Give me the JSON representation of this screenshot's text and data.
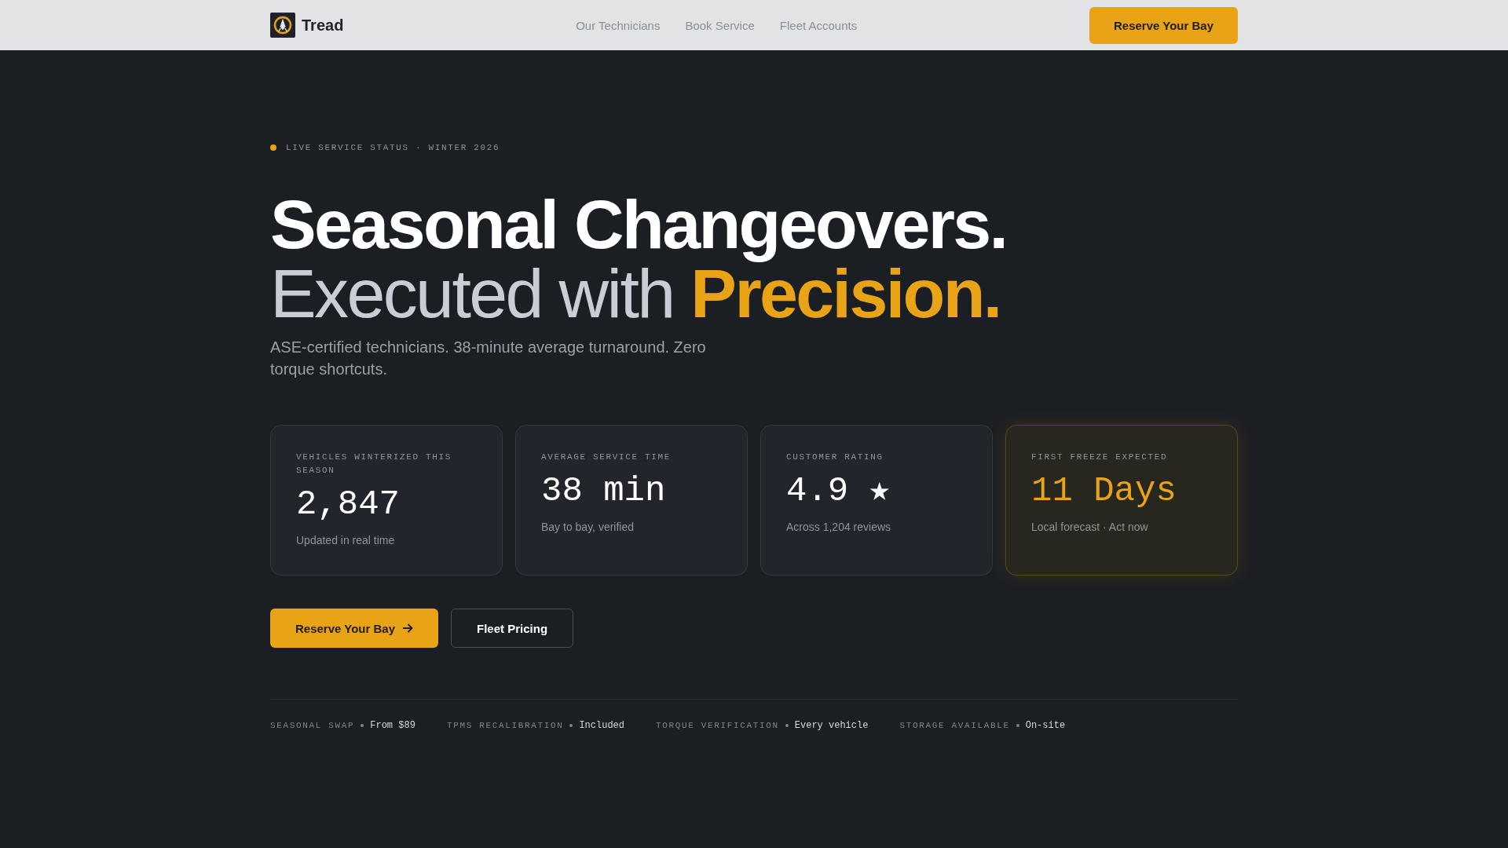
{
  "nav": {
    "brand": "Tread",
    "links": [
      "Our Technicians",
      "Book Service",
      "Fleet Accounts"
    ],
    "cta": "Reserve Your Bay"
  },
  "hero": {
    "status": "LIVE SERVICE STATUS · WINTER 2026",
    "headline_line_1": "Seasonal Changeovers.",
    "headline_line_2": "Executed with **Precision.**",
    "subtitle": "ASE-certified technicians. 38-minute average turnaround. Zero torque shortcuts."
  },
  "stats": [
    {
      "label": "VEHICLES WINTERIZED THIS SEASON",
      "value": "2,847",
      "note": "Updated in real time",
      "highlighted": false
    },
    {
      "label": "AVERAGE SERVICE TIME",
      "value": "38 min",
      "note": "Bay to bay, verified",
      "highlighted": false
    },
    {
      "label": "CUSTOMER RATING",
      "value": "4.9 ★",
      "note": "Across 1,204 reviews",
      "highlighted": false
    },
    {
      "label": "FIRST FREEZE EXPECTED",
      "value": "11 Days",
      "note": "Local forecast · Act now",
      "highlighted": true
    }
  ],
  "actions": [
    {
      "label": "Reserve Your Bay",
      "kind": "primary"
    },
    {
      "label": "Fleet Pricing",
      "kind": "secondary"
    }
  ],
  "features": [
    {
      "label": "SEASONAL SWAP",
      "value": "From $89"
    },
    {
      "label": "TPMS RECALIBRATION",
      "value": "Included"
    },
    {
      "label": "TORQUE VERIFICATION",
      "value": "Every vehicle"
    },
    {
      "label": "STORAGE AVAILABLE",
      "value": "On-site"
    }
  ]
}
